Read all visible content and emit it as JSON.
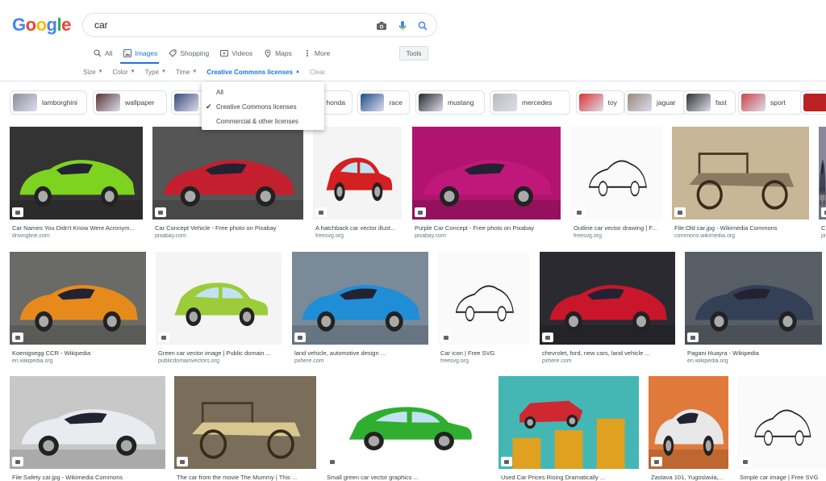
{
  "header": {
    "logo": "Google",
    "search_value": "car",
    "tabs": [
      {
        "label": "All",
        "icon": "search-icon"
      },
      {
        "label": "Images",
        "icon": "image-icon",
        "active": true
      },
      {
        "label": "Shopping",
        "icon": "tag-icon"
      },
      {
        "label": "Videos",
        "icon": "play-icon"
      },
      {
        "label": "Maps",
        "icon": "pin-icon"
      },
      {
        "label": "More",
        "icon": "dots-icon"
      }
    ],
    "tools_label": "Tools",
    "filters": [
      "Size",
      "Color",
      "Type",
      "Time",
      "Creative Commons licenses",
      "Clear"
    ]
  },
  "license_menu": {
    "items": [
      "All",
      "Creative Commons licenses",
      "Commercial & other licenses"
    ],
    "selected": "Creative Commons licenses"
  },
  "chips": [
    "lamborghini",
    "wallpaper",
    "",
    "honda",
    "race",
    "mustang",
    "mercedes",
    "toy",
    "jaguar",
    "fast",
    "sport"
  ],
  "results": {
    "row1": [
      {
        "title": "Car Names You Didn't Know Were Acronym...",
        "source": "drivingline.com"
      },
      {
        "title": "Car Concept Vehicle - Free photo on Pixabay",
        "source": "pixabay.com"
      },
      {
        "title": "A hatchback car vector illust...",
        "source": "freesvg.org"
      },
      {
        "title": "Purple Car Concept - Free photo on Pixabay",
        "source": "pixabay.com"
      },
      {
        "title": "Outline car vector drawing | F...",
        "source": "freesvg.org"
      },
      {
        "title": "File:Old car.jpg - Wikimedia Commons",
        "source": "commons.wikimedia.org"
      },
      {
        "title": "C",
        "source": "pi"
      }
    ],
    "row2": [
      {
        "title": "Koenigsegg CCR - Wikipedia",
        "source": "en.wikipedia.org"
      },
      {
        "title": "Green car vector image | Public domain ...",
        "source": "publicdomainvectors.org"
      },
      {
        "title": "land vehicle, automotive design ...",
        "source": "pxhere.com"
      },
      {
        "title": "Car icon | Free SVG",
        "source": "freesvg.org"
      },
      {
        "title": "chevrolet, ford, new cars, land vehicle ...",
        "source": "pxhere.com"
      },
      {
        "title": "Pagani Huayra - Wikipedia",
        "source": "en.wikipedia.org"
      }
    ],
    "row3": [
      {
        "title": "File:Safety car.jpg - Wikimedia Commons",
        "source": ""
      },
      {
        "title": "The car from the movie The Mummy | This ...",
        "source": ""
      },
      {
        "title": "Small green car vector graphics ...",
        "source": ""
      },
      {
        "title": "Used Car Prices Rising Dramatically ...",
        "source": ""
      },
      {
        "title": "Zastava 101, Yugoslavia,...",
        "source": ""
      },
      {
        "title": "Simple car image | Free SVG",
        "source": ""
      }
    ]
  },
  "colors": {
    "accent": "#1a73e8",
    "text": "#202124",
    "muted": "#70757a"
  }
}
